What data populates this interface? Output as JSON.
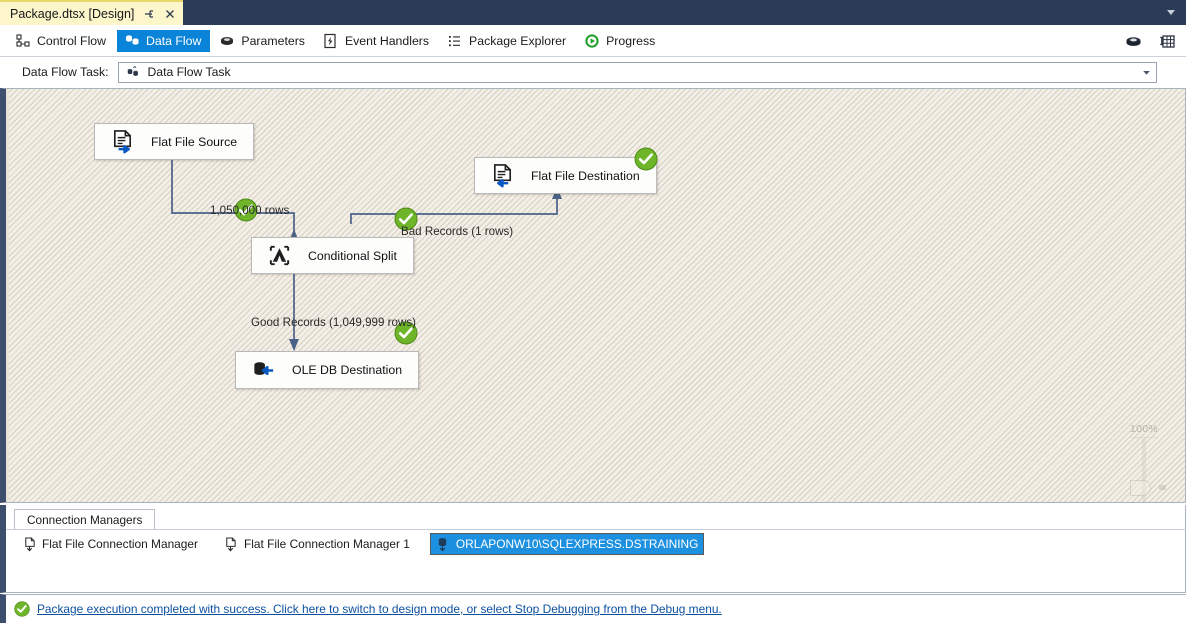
{
  "window": {
    "document_tab": {
      "title": "Package.dtsx [Design]",
      "pin_icon": "pin-icon",
      "close_icon": "close-icon"
    },
    "tabstrip_overflow_icon": "chevron-down-icon"
  },
  "designer_tabs": [
    {
      "label": "Control Flow",
      "icon": "control-flow-icon",
      "active": false
    },
    {
      "label": "Data Flow",
      "icon": "data-flow-icon",
      "active": true
    },
    {
      "label": "Parameters",
      "icon": "parameters-icon",
      "active": false
    },
    {
      "label": "Event Handlers",
      "icon": "event-handlers-icon",
      "active": false
    },
    {
      "label": "Package Explorer",
      "icon": "package-explorer-icon",
      "active": false
    },
    {
      "label": "Progress",
      "icon": "progress-icon",
      "active": false
    }
  ],
  "toolbar_right": [
    {
      "icon": "parameters-package-icon"
    },
    {
      "icon": "variables-grid-icon"
    }
  ],
  "task_selector": {
    "label": "Data Flow Task:",
    "value": "Data Flow Task",
    "icon": "data-flow-task-icon",
    "dropdown_icon": "chevron-down-icon"
  },
  "canvas": {
    "nodes": [
      {
        "id": "flat-file-source",
        "label": "Flat File Source",
        "icon": "flat-file-source-icon",
        "status": "success"
      },
      {
        "id": "flat-file-destination",
        "label": "Flat File Destination",
        "icon": "flat-file-destination-icon",
        "status": "success"
      },
      {
        "id": "conditional-split",
        "label": "Conditional Split",
        "icon": "conditional-split-icon",
        "status": "success"
      },
      {
        "id": "ole-db-destination",
        "label": "OLE DB Destination",
        "icon": "ole-db-destination-icon",
        "status": "success"
      }
    ],
    "path_labels": [
      {
        "id": "source-to-split",
        "text": "1,050,000 rows"
      },
      {
        "id": "bad-records-path",
        "text": "Bad Records (1 rows)"
      },
      {
        "id": "good-records-path",
        "text": "Good Records (1,049,999 rows)"
      }
    ],
    "zoom": {
      "percent": "100%",
      "fit_icon": "fit-to-window-icon"
    }
  },
  "connection_managers": {
    "tab_label": "Connection Managers",
    "items": [
      {
        "label": "Flat File Connection Manager",
        "icon": "flat-file-connection-icon",
        "selected": false
      },
      {
        "label": "Flat File Connection Manager 1",
        "icon": "flat-file-connection-icon",
        "selected": false
      },
      {
        "label": "ORLAPONW10\\SQLEXPRESS.DSTRAINING",
        "icon": "ole-db-connection-icon",
        "selected": true
      }
    ]
  },
  "status_bar": {
    "icon": "success-check-icon",
    "message": "Package execution completed with success. Click here to switch to design mode, or select Stop Debugging from the Debug menu."
  },
  "colors": {
    "accent_blue": "#0a84d8",
    "title_bar": "#2d3c56",
    "doc_tab": "#fdf6ca",
    "canvas_bg": "#f4efe6",
    "wire": "#4a6287",
    "success_green": "#5aa823",
    "link_blue": "#0b4f9e",
    "selection_blue": "#1e90e0"
  }
}
